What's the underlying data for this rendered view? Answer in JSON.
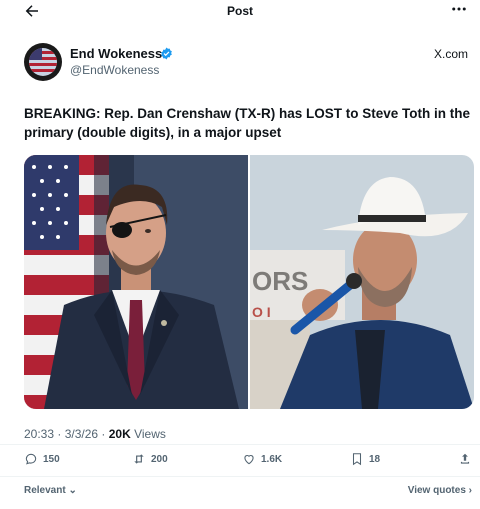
{
  "header": {
    "title": "Post"
  },
  "author": {
    "name": "End Wokeness",
    "handle": "@EndWokeness",
    "source": "X.com"
  },
  "tweet": {
    "text": "BREAKING: Rep. Dan Crenshaw (TX-R) has LOST to Steve Toth in the primary (double digits), in a major upset"
  },
  "meta": {
    "timestamp": "20:33 · 3/3/26 · ",
    "views_count": "20K",
    "views_label": " Views"
  },
  "actions": {
    "replies": "150",
    "reposts": "200",
    "likes": "1.6K",
    "bookmarks": "18"
  },
  "footer": {
    "sort": "Relevant",
    "view_quotes": "View quotes"
  },
  "colors": {
    "verified": "#1d9bf0",
    "text": "#0f1419",
    "muted": "#536471"
  }
}
